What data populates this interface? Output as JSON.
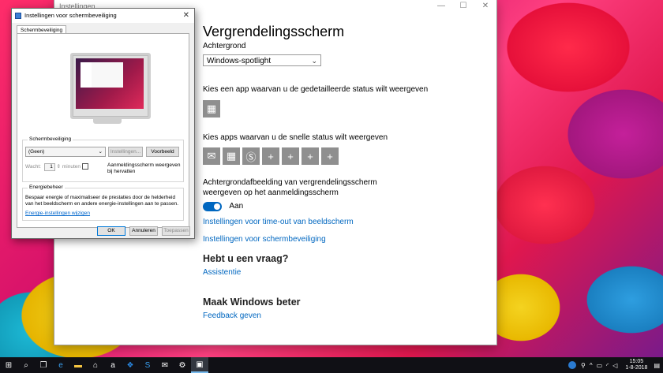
{
  "settings": {
    "window_title": "Instellingen",
    "controls": {
      "minimize": "—",
      "maximize": "☐",
      "close": "✕"
    },
    "page_title": "Vergrendelingsscherm",
    "background_label": "Achtergrond",
    "background_value": "Windows-spotlight",
    "detailed_status_label": "Kies een app waarvan u de gedetailleerde status wilt weergeven",
    "quick_status_label": "Kies apps waarvan u de snelle status wilt weergeven",
    "show_bg_label": "Achtergrondafbeelding van vergrendelingsscherm weergeven op het aanmeldingsscherm",
    "toggle_label": "Aan",
    "link_timeout": "Instellingen voor time-out van beeldscherm",
    "link_screensaver": "Instellingen voor schermbeveiliging",
    "question_heading": "Hebt u een vraag?",
    "question_link": "Assistentie",
    "improve_heading": "Maak Windows beter",
    "improve_link": "Feedback geven"
  },
  "dialog": {
    "title": "Instellingen voor schermbeveiliging",
    "close": "✕",
    "tab": "Schermbeveiliging",
    "group_screensaver": "Schermbeveiliging",
    "screensaver_value": "(Geen)",
    "btn_settings": "Instellingen...",
    "btn_preview": "Voorbeeld",
    "wait_label": "Wacht:",
    "wait_value": "1",
    "minutes_label": "minuten",
    "resume_label": "Aanmeldingsscherm weergeven bij hervatten",
    "group_power": "Energiebeheer",
    "power_text": "Bespaar energie of maximaliseer de prestaties door de helderheid van het beeldscherm en andere energie-instellingen aan te passen.",
    "power_link": "Energie-instellingen wijzigen",
    "btn_ok": "OK",
    "btn_cancel": "Annuleren",
    "btn_apply": "Toepassen"
  },
  "taskbar": {
    "clock_time": "15:05",
    "clock_date": "1-8-2018"
  }
}
